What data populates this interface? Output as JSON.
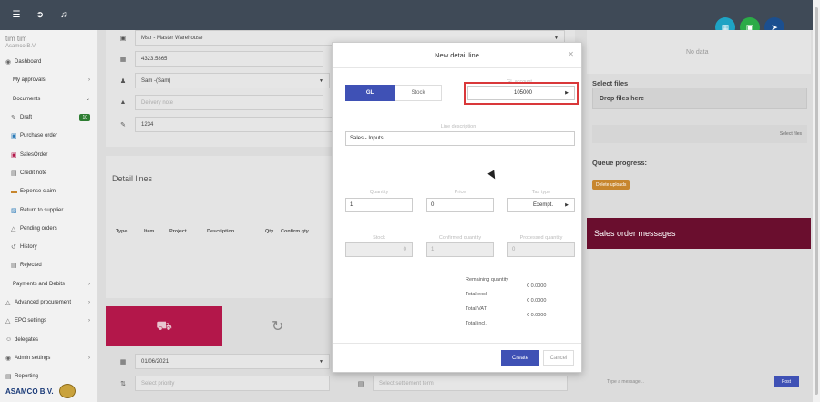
{
  "topbar": {
    "icons": [
      "menu-icon",
      "logout-icon",
      "bell-icon"
    ],
    "fabs": [
      {
        "icon": "file-icon",
        "color": "#1ea3c4"
      },
      {
        "icon": "save-icon",
        "color": "#2bab47"
      },
      {
        "icon": "send-icon",
        "color": "#1b4f8f"
      }
    ]
  },
  "user": {
    "name": "tim tim",
    "org": "Asamco B.V."
  },
  "sidebar": {
    "items": [
      {
        "label": "Dashboard",
        "icon": "dashboard-icon"
      },
      {
        "label": "My approvals",
        "chevron": true
      },
      {
        "label": "Documents",
        "chevron": true
      },
      {
        "label": "Draft",
        "icon": "draft-icon",
        "badge": "10"
      },
      {
        "label": "Purchase order",
        "icon": "cart-icon"
      },
      {
        "label": "SalesOrder",
        "icon": "salesorder-icon"
      },
      {
        "label": "Credit note",
        "icon": "creditnote-icon"
      },
      {
        "label": "Expense claim",
        "icon": "expense-icon"
      },
      {
        "label": "Return to supplier",
        "icon": "return-icon"
      },
      {
        "label": "Pending orders",
        "icon": "pending-icon"
      },
      {
        "label": "History",
        "icon": "history-icon"
      },
      {
        "label": "Rejected",
        "icon": "rejected-icon"
      },
      {
        "label": "Payments and Debits",
        "chevron": true
      },
      {
        "label": "Advanced procurement",
        "icon": "procurement-icon",
        "chevron": true
      },
      {
        "label": "EPO settings",
        "icon": "settings-icon",
        "chevron": true
      },
      {
        "label": "delegates",
        "icon": "delegates-icon"
      },
      {
        "label": "Admin settings",
        "icon": "admin-icon",
        "chevron": true
      },
      {
        "label": "Reporting",
        "icon": "reporting-icon"
      }
    ],
    "brand": "ASAMCO B.V."
  },
  "background": {
    "fields": [
      {
        "icon": "warehouse-icon",
        "value": "Mstr - Master Warehouse",
        "caret": true
      },
      {
        "icon": "hash-icon",
        "value": "4323.5865",
        "caret": false
      },
      {
        "icon": "user-icon",
        "value": "Sam -(Sam)",
        "caret": true
      },
      {
        "icon": "delivery-icon",
        "value": "Delivery note",
        "placeholder": true,
        "caret": false
      },
      {
        "icon": "pencil-icon",
        "value": "1234",
        "caret": false
      }
    ],
    "detail_title": "Detail lines",
    "table_headers": [
      "Type",
      "Item",
      "Project",
      "Description",
      "Qty",
      "Confirm qty"
    ],
    "date_value": "01/06/2021",
    "priority_placeholder": "Select priority",
    "settlement_placeholder": "Select settlement term",
    "no_data": "No data",
    "select_files": "Select files",
    "drop_files": "Drop files here",
    "select_files_btn": "Select files",
    "queue_progress": "Queue progress:",
    "delete_uploads": "Delete uploads",
    "sales_messages": "Sales order messages",
    "message_placeholder": "Type a message...",
    "post": "Post"
  },
  "modal": {
    "title": "New detail line",
    "toggle": {
      "gl": "GL",
      "stock": "Stock"
    },
    "gl_account_label": "GL account",
    "gl_account_value": "105000",
    "line_description_label": "Line description",
    "line_description_value": "Sales - Inputs",
    "quantity_label": "Quantity",
    "quantity_value": "1",
    "price_label": "Price",
    "price_value": "0",
    "tax_type_label": "Tax type",
    "tax_type_value": "Exempt.",
    "stock_label": "Stock",
    "stock_value": "0",
    "confirmed_label": "Confirmed quantity",
    "confirmed_value": "1",
    "processed_label": "Processed quantity",
    "processed_value": "0",
    "summary": {
      "remaining_label": "Remaining quantity",
      "total_excl_label": "Total excl.",
      "total_excl_value": "€ 0.0000",
      "total_vat_label": "Total VAT",
      "total_vat_value": "€ 0.0000",
      "total_incl_label": "Total incl.",
      "total_incl_value": "€ 0.0000"
    },
    "create": "Create",
    "cancel": "Cancel",
    "highlight_color": "#d9383a",
    "accent": "#3f51b5"
  }
}
